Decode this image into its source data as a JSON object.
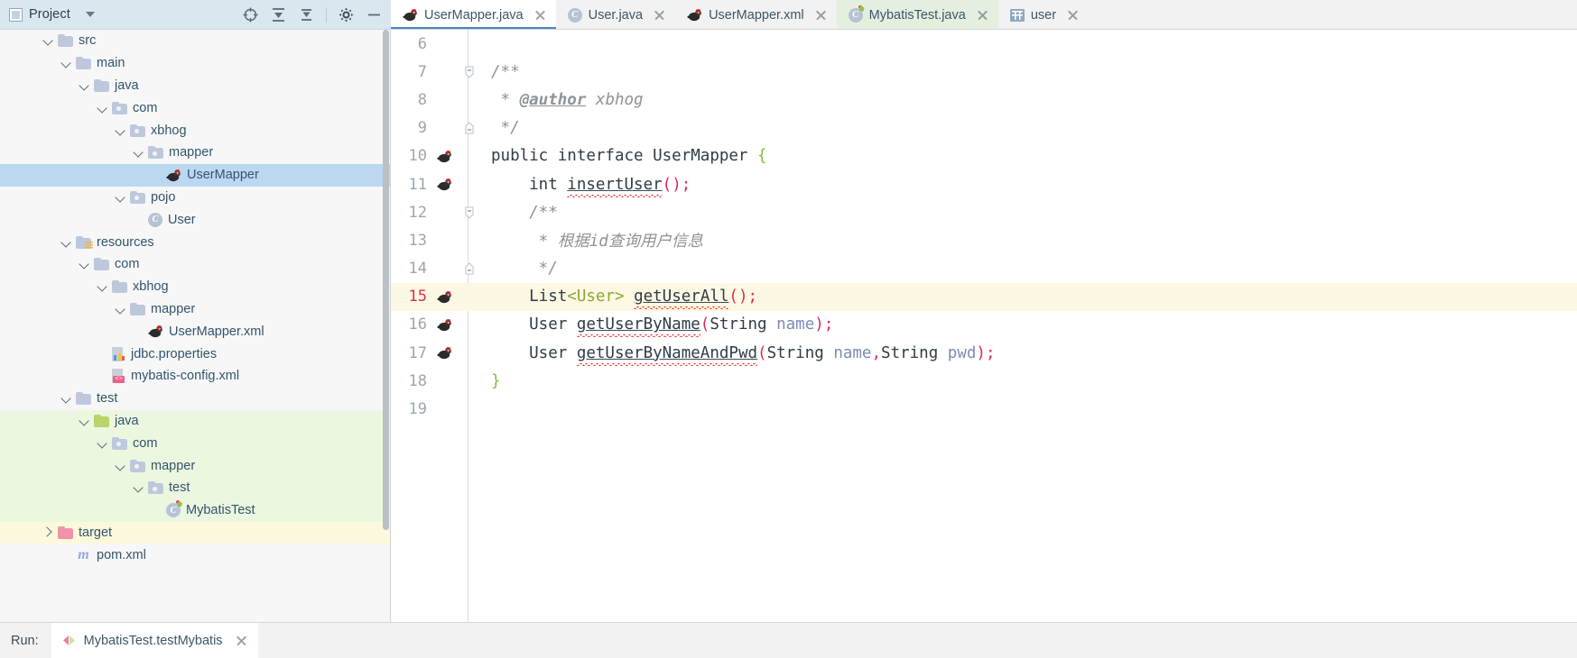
{
  "project_toolbar": {
    "title": "Project",
    "dropdown_icon": "chevron-down-icon",
    "tools": [
      "locate-icon",
      "collapse-all-icon",
      "expand-all-icon",
      "settings-icon",
      "hide-icon"
    ]
  },
  "editor_tabs": [
    {
      "label": "UserMapper.java",
      "icon": "mybatis-mapper-icon",
      "active": true,
      "tinted": false,
      "closable": true
    },
    {
      "label": "User.java",
      "icon": "java-class-icon",
      "active": false,
      "tinted": false,
      "closable": true
    },
    {
      "label": "UserMapper.xml",
      "icon": "mybatis-mapper-icon",
      "active": false,
      "tinted": false,
      "closable": true
    },
    {
      "label": "MybatisTest.java",
      "icon": "java-test-class-icon",
      "active": false,
      "tinted": true,
      "closable": true
    },
    {
      "label": "user",
      "icon": "database-table-icon",
      "active": false,
      "tinted": false,
      "closable": true
    }
  ],
  "project_tree": [
    {
      "label": "src",
      "indent": 2,
      "arrow": "open",
      "icon": "folder-icon",
      "state": "none"
    },
    {
      "label": "main",
      "indent": 3,
      "arrow": "open",
      "icon": "folder-icon",
      "state": "none"
    },
    {
      "label": "java",
      "indent": 4,
      "arrow": "open",
      "icon": "folder-icon",
      "state": "none"
    },
    {
      "label": "com",
      "indent": 5,
      "arrow": "open",
      "icon": "package-folder-icon",
      "state": "none"
    },
    {
      "label": "xbhog",
      "indent": 6,
      "arrow": "open",
      "icon": "package-folder-icon",
      "state": "none"
    },
    {
      "label": "mapper",
      "indent": 7,
      "arrow": "open",
      "icon": "package-folder-icon",
      "state": "none"
    },
    {
      "label": "UserMapper",
      "indent": 8,
      "arrow": "none",
      "icon": "mybatis-mapper-icon",
      "state": "selected"
    },
    {
      "label": "pojo",
      "indent": 6,
      "arrow": "open",
      "icon": "package-folder-icon",
      "state": "none"
    },
    {
      "label": "User",
      "indent": 7,
      "arrow": "none",
      "icon": "java-class-icon",
      "state": "none"
    },
    {
      "label": "resources",
      "indent": 3,
      "arrow": "open",
      "icon": "resources-folder-icon",
      "state": "none"
    },
    {
      "label": "com",
      "indent": 4,
      "arrow": "open",
      "icon": "folder-icon",
      "state": "none"
    },
    {
      "label": "xbhog",
      "indent": 5,
      "arrow": "open",
      "icon": "folder-icon",
      "state": "none"
    },
    {
      "label": "mapper",
      "indent": 6,
      "arrow": "open",
      "icon": "folder-icon",
      "state": "none"
    },
    {
      "label": "UserMapper.xml",
      "indent": 7,
      "arrow": "none",
      "icon": "mybatis-mapper-icon",
      "state": "none"
    },
    {
      "label": "jdbc.properties",
      "indent": 5,
      "arrow": "none",
      "icon": "properties-file-icon",
      "state": "none"
    },
    {
      "label": "mybatis-config.xml",
      "indent": 5,
      "arrow": "none",
      "icon": "xml-file-icon",
      "state": "none"
    },
    {
      "label": "test",
      "indent": 3,
      "arrow": "open",
      "icon": "folder-icon",
      "state": "none"
    },
    {
      "label": "java",
      "indent": 4,
      "arrow": "open",
      "icon": "test-source-folder-icon",
      "state": "test"
    },
    {
      "label": "com",
      "indent": 5,
      "arrow": "open",
      "icon": "package-folder-icon",
      "state": "test"
    },
    {
      "label": "mapper",
      "indent": 6,
      "arrow": "open",
      "icon": "package-folder-icon",
      "state": "test"
    },
    {
      "label": "test",
      "indent": 7,
      "arrow": "open",
      "icon": "package-folder-icon",
      "state": "test"
    },
    {
      "label": "MybatisTest",
      "indent": 8,
      "arrow": "none",
      "icon": "java-test-class-icon",
      "state": "test"
    },
    {
      "label": "target",
      "indent": 2,
      "arrow": "closed",
      "icon": "excluded-folder-icon",
      "state": "excluded"
    },
    {
      "label": "pom.xml",
      "indent": 3,
      "arrow": "none",
      "icon": "maven-file-icon",
      "state": "none"
    }
  ],
  "code": {
    "file": "UserMapper.java",
    "first_line_number": 6,
    "caret_line": 15,
    "lines": [
      {
        "n": 6,
        "marker": "",
        "fold": "",
        "indent": 0,
        "tokens": []
      },
      {
        "n": 7,
        "marker": "",
        "fold": "minus",
        "indent": 0,
        "tokens": [
          {
            "t": "/**",
            "c": "cmt"
          }
        ]
      },
      {
        "n": 8,
        "marker": "",
        "fold": "",
        "indent": 0,
        "tokens": [
          {
            "t": " * ",
            "c": "cmt"
          },
          {
            "t": "@author",
            "c": "cmt-bold"
          },
          {
            "t": " xbhog",
            "c": "cmt"
          }
        ]
      },
      {
        "n": 9,
        "marker": "",
        "fold": "end",
        "indent": 0,
        "tokens": [
          {
            "t": " */",
            "c": "cmt"
          }
        ]
      },
      {
        "n": 10,
        "marker": "mybatis",
        "fold": "",
        "indent": 0,
        "tokens": [
          {
            "t": "public interface UserMapper ",
            "c": "kw"
          },
          {
            "t": "{",
            "c": "brace-g"
          }
        ]
      },
      {
        "n": 11,
        "marker": "mybatis",
        "fold": "",
        "indent": 0,
        "tokens": [
          {
            "t": "    int ",
            "c": "kw"
          },
          {
            "t": "insertUser",
            "c": "mname"
          },
          {
            "t": "()",
            "c": "punct-r"
          },
          {
            "t": ";",
            "c": "punct-r"
          }
        ]
      },
      {
        "n": 12,
        "marker": "",
        "fold": "minus",
        "indent": 0,
        "tokens": [
          {
            "t": "    /**",
            "c": "cmt"
          }
        ]
      },
      {
        "n": 13,
        "marker": "",
        "fold": "",
        "indent": 0,
        "tokens": [
          {
            "t": "     * 根据id查询用户信息",
            "c": "cmt"
          }
        ]
      },
      {
        "n": 14,
        "marker": "",
        "fold": "end",
        "indent": 0,
        "tokens": [
          {
            "t": "     */",
            "c": "cmt"
          }
        ]
      },
      {
        "n": 15,
        "marker": "mybatis",
        "fold": "",
        "indent": 0,
        "tokens": [
          {
            "t": "    List",
            "c": "kw"
          },
          {
            "t": "<User>",
            "c": "gen"
          },
          {
            "t": " ",
            "c": "kw"
          },
          {
            "t": "getUserAll",
            "c": "mname"
          },
          {
            "t": "()",
            "c": "punct-r"
          },
          {
            "t": ";",
            "c": "punct-r"
          }
        ]
      },
      {
        "n": 16,
        "marker": "mybatis",
        "fold": "",
        "indent": 0,
        "tokens": [
          {
            "t": "    User ",
            "c": "kw"
          },
          {
            "t": "getUserByName",
            "c": "mname"
          },
          {
            "t": "(",
            "c": "punct-r"
          },
          {
            "t": "String ",
            "c": "kw"
          },
          {
            "t": "name",
            "c": "param"
          },
          {
            "t": ")",
            "c": "punct-r"
          },
          {
            "t": ";",
            "c": "punct-r"
          }
        ]
      },
      {
        "n": 17,
        "marker": "mybatis",
        "fold": "",
        "indent": 0,
        "tokens": [
          {
            "t": "    User ",
            "c": "kw"
          },
          {
            "t": "getUserByNameAndPwd",
            "c": "mname"
          },
          {
            "t": "(",
            "c": "punct-r"
          },
          {
            "t": "String ",
            "c": "kw"
          },
          {
            "t": "name",
            "c": "param"
          },
          {
            "t": ",",
            "c": "punct-r"
          },
          {
            "t": "String ",
            "c": "kw"
          },
          {
            "t": "pwd",
            "c": "param"
          },
          {
            "t": ")",
            "c": "punct-r"
          },
          {
            "t": ";",
            "c": "punct-r"
          }
        ]
      },
      {
        "n": 18,
        "marker": "",
        "fold": "",
        "indent": 0,
        "tokens": [
          {
            "t": "}",
            "c": "brace-g"
          }
        ]
      },
      {
        "n": 19,
        "marker": "",
        "fold": "",
        "indent": 0,
        "tokens": []
      }
    ]
  },
  "run_bar": {
    "label": "Run:",
    "tab_label": "MybatisTest.testMybatis",
    "tab_icon": "run-configuration-icon",
    "closable": true
  },
  "colors": {
    "toolbar_bg": "#dbe7ef",
    "selection_blue": "#bcd7f0",
    "test_green": "#ecf7e0",
    "excluded_yellow": "#fcf8db",
    "caret_line": "#fdf8e3",
    "active_tab_underline": "#4683c9",
    "caret_line_number": "#e0295b",
    "punctuation_red": "#e0295b",
    "generic_olive": "#8fa832",
    "brace_green": "#7fbf3f",
    "parameter_blue": "#7b8bb5",
    "comment_gray": "#8c9398"
  }
}
